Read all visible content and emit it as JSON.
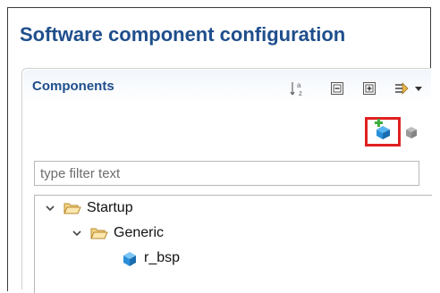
{
  "header": {
    "title": "Software component configuration"
  },
  "components": {
    "title": "Components",
    "toolbar": {
      "sort_icon": "sort-alpha-icon",
      "collapse_icon": "collapse-all-icon",
      "expand_icon": "expand-all-icon",
      "filter_icon": "filter-options-icon",
      "menu_icon": "view-menu-icon"
    },
    "add_icon": "add-component-icon",
    "remove_icon": "remove-component-icon",
    "filter": {
      "placeholder": "type filter text",
      "value": ""
    },
    "tree": [
      {
        "label": "Startup",
        "expanded": true
      },
      {
        "label": "Generic",
        "expanded": true
      },
      {
        "label": "r_bsp"
      }
    ]
  },
  "colors": {
    "title": "#1f4e8c",
    "highlight_border": "#e02020",
    "folder": "#e8b54a",
    "component": "#2a8fd8"
  }
}
